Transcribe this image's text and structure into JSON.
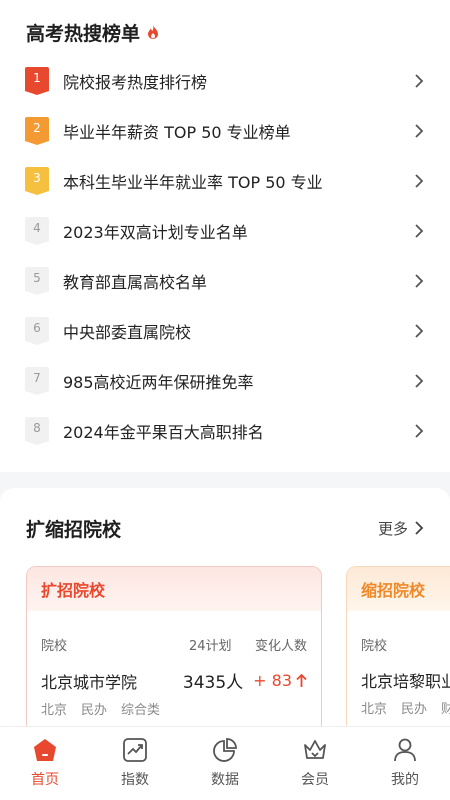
{
  "hot": {
    "title": "高考热搜榜单",
    "items": [
      {
        "rank": "1",
        "text": "院校报考热度排行榜"
      },
      {
        "rank": "2",
        "text": "毕业半年薪资 TOP 50 专业榜单"
      },
      {
        "rank": "3",
        "text": "本科生毕业半年就业率 TOP 50 专业"
      },
      {
        "rank": "4",
        "text": "2023年双高计划专业名单"
      },
      {
        "rank": "5",
        "text": "教育部直属高校名单"
      },
      {
        "rank": "6",
        "text": "中央部委直属院校"
      },
      {
        "rank": "7",
        "text": "985高校近两年保研推免率"
      },
      {
        "rank": "8",
        "text": "2024年金平果百大高职排名"
      }
    ]
  },
  "expand": {
    "title": "扩缩招院校",
    "more_label": "更多",
    "cards": [
      {
        "title": "扩招院校",
        "col_school": "院校",
        "col_plan": "24计划",
        "col_change": "变化人数",
        "school": "北京城市学院",
        "plan": "3435人",
        "change": "+ 83",
        "tags": [
          "北京",
          "民办",
          "综合类"
        ]
      },
      {
        "title": "缩招院校",
        "col_school": "院校",
        "school": "北京培黎职业",
        "tags": [
          "北京",
          "民办",
          "财"
        ]
      }
    ]
  },
  "tabs": [
    {
      "label": "首页",
      "icon": "home-icon",
      "active": true
    },
    {
      "label": "指数",
      "icon": "chart-icon",
      "active": false
    },
    {
      "label": "数据",
      "icon": "pie-icon",
      "active": false
    },
    {
      "label": "会员",
      "icon": "crown-icon",
      "active": false
    },
    {
      "label": "我的",
      "icon": "person-icon",
      "active": false
    }
  ],
  "colors": {
    "accent": "#e8492e",
    "gold": "#f6b33b",
    "orange": "#ef8a2b"
  }
}
